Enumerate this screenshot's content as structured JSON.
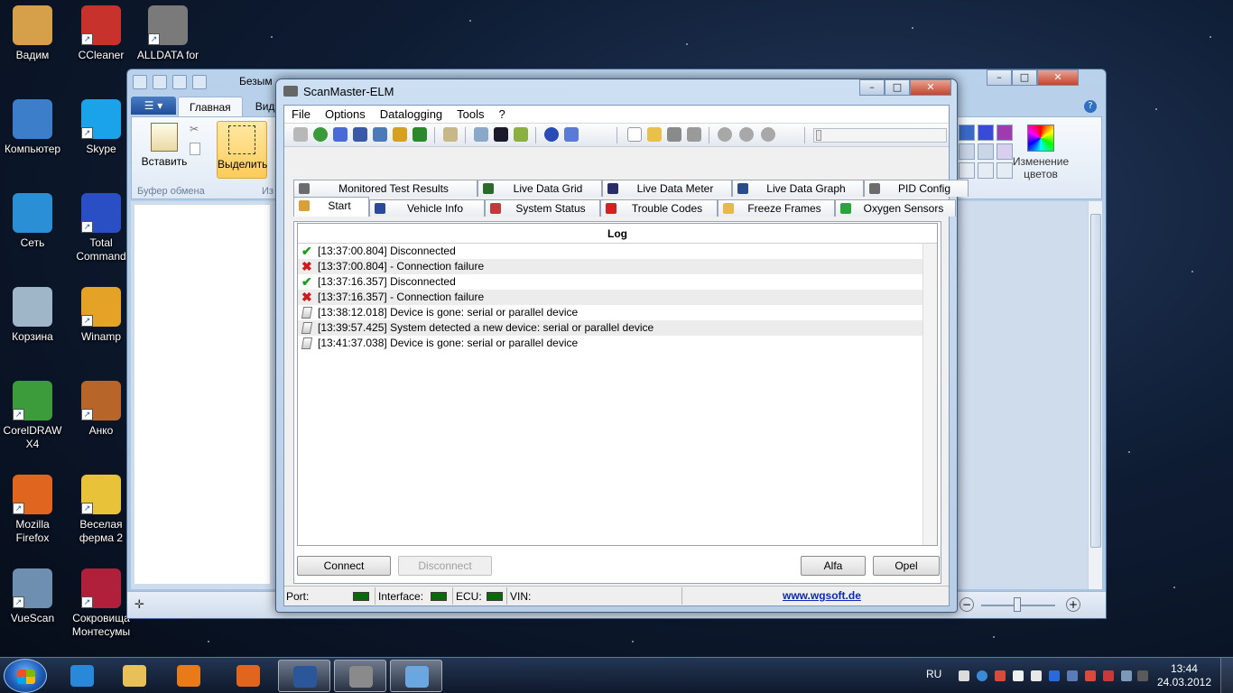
{
  "desktop": {
    "icons": [
      {
        "label": "Вадим",
        "color": "#d6a04a"
      },
      {
        "label": "CCleaner",
        "color": "#c8322c"
      },
      {
        "label": "ALLDATA for",
        "color": "#7a7a7a"
      },
      {
        "label": "Компьютер",
        "color": "#3c7ec9"
      },
      {
        "label": "Skype",
        "color": "#1aa3e8"
      },
      {
        "label": "Сеть",
        "color": "#2a8fd4"
      },
      {
        "label": "Total Command",
        "color": "#2a4fc4"
      },
      {
        "label": "Корзина",
        "color": "#9fb6c9"
      },
      {
        "label": "Winamp",
        "color": "#e4a226"
      },
      {
        "label": "CorelDRAW X4",
        "color": "#3c9c3c"
      },
      {
        "label": "Анко",
        "color": "#b8652a"
      },
      {
        "label": "Mozilla Firefox",
        "color": "#e0661f"
      },
      {
        "label": "Веселая ферма 2",
        "color": "#e8c33a"
      },
      {
        "label": "VueScan",
        "color": "#6e8fb0"
      },
      {
        "label": "Сокровища Монтесумы",
        "color": "#b0203a"
      }
    ]
  },
  "paint": {
    "title": "Безым",
    "tabs": [
      "Главная",
      "Вид"
    ],
    "paste_label": "Вставить",
    "select_label": "Выделить",
    "clipboard_group": "Буфер обмена",
    "image_group": "Из",
    "edit_colors_label": "Изменение цветов"
  },
  "scanmaster": {
    "title": "ScanMaster-ELM",
    "menu": [
      "File",
      "Options",
      "Datalogging",
      "Tools",
      "?"
    ],
    "tabs_top": [
      {
        "label": "Monitored Test Results",
        "icon": "gear-icon",
        "color": "#6c6c6c"
      },
      {
        "label": "Live Data Grid",
        "icon": "grid-icon",
        "color": "#2b6a2b"
      },
      {
        "label": "Live Data Meter",
        "icon": "meter-icon",
        "color": "#2b2b6a"
      },
      {
        "label": "Live Data Graph",
        "icon": "graph-icon",
        "color": "#2b4c8a"
      },
      {
        "label": "PID Config",
        "icon": "document-icon",
        "color": "#6c6c6c"
      }
    ],
    "tabs_bottom": [
      {
        "label": "Start",
        "icon": "home-icon",
        "color": "#d9a03a"
      },
      {
        "label": "Vehicle Info",
        "icon": "info-icon",
        "color": "#2a4a9a"
      },
      {
        "label": "System Status",
        "icon": "status-icon",
        "color": "#c23a3a"
      },
      {
        "label": "Trouble Codes",
        "icon": "error-icon",
        "color": "#d82020"
      },
      {
        "label": "Freeze Frames",
        "icon": "hand-icon",
        "color": "#e8b84a"
      },
      {
        "label": "Oxygen Sensors",
        "icon": "sensor-icon",
        "color": "#2aa43a"
      }
    ],
    "log_header": "Log",
    "log": [
      {
        "type": "ok",
        "text": "[13:37:00.804] Disconnected"
      },
      {
        "type": "err",
        "text": "[13:37:00.804]  - Connection failure"
      },
      {
        "type": "ok",
        "text": "[13:37:16.357] Disconnected"
      },
      {
        "type": "err",
        "text": "[13:37:16.357]  - Connection failure"
      },
      {
        "type": "plug",
        "text": "[13:38:12.018] Device is gone: serial or parallel device"
      },
      {
        "type": "plug",
        "text": "[13:39:57.425] System detected a new device: serial or parallel device"
      },
      {
        "type": "plug",
        "text": "[13:41:37.038] Device is gone: serial or parallel device"
      }
    ],
    "buttons": {
      "connect": "Connect",
      "disconnect": "Disconnect",
      "alfa": "Alfa",
      "opel": "Opel"
    },
    "status": {
      "port": "Port:",
      "interface": "Interface:",
      "ecu": "ECU:",
      "vin": "VIN:",
      "link": "www.wgsoft.de",
      "led_color": "#0a6a0a"
    }
  },
  "taskbar": {
    "apps": [
      {
        "name": "internet-explorer",
        "color": "#2a88d8"
      },
      {
        "name": "explorer",
        "color": "#e8c05a"
      },
      {
        "name": "media-player",
        "color": "#e87a1a"
      },
      {
        "name": "firefox",
        "color": "#e0661f"
      },
      {
        "name": "word",
        "color": "#2b579a"
      },
      {
        "name": "scanmaster",
        "color": "#8a8a8a"
      },
      {
        "name": "paint",
        "color": "#6aa6e0"
      }
    ],
    "lang": "RU",
    "time": "13:44",
    "date": "24.03.2012"
  }
}
